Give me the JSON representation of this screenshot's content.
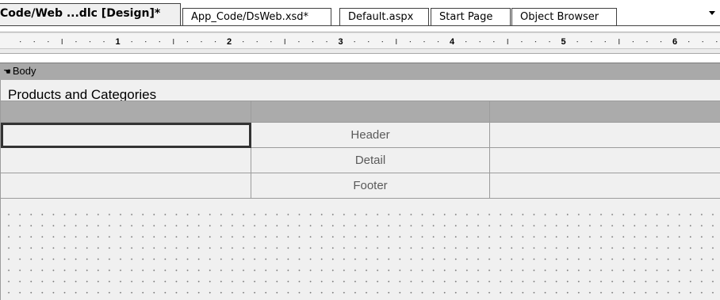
{
  "tabs": [
    {
      "label": "Code/Web ...dlc [Design]*",
      "active": true
    },
    {
      "label": "App_Code/DsWeb.xsd*",
      "active": false
    },
    {
      "label": "Default.aspx",
      "active": false
    },
    {
      "label": "Start Page",
      "active": false
    },
    {
      "label": "Object Browser",
      "active": false
    }
  ],
  "ruler": {
    "numbers": [
      "1",
      "2",
      "3",
      "4",
      "5",
      "6"
    ]
  },
  "section": {
    "bullet": "☚",
    "label": "Body"
  },
  "report": {
    "title": "Products and Categories"
  },
  "table": {
    "rows": [
      [
        "",
        "",
        ""
      ],
      [
        "",
        "Header",
        ""
      ],
      [
        "",
        "Detail",
        ""
      ],
      [
        "",
        "Footer",
        ""
      ]
    ]
  },
  "icons": {
    "tab_dropdown": "chevron-down-icon",
    "section_marker": "pointing-hand-icon"
  }
}
